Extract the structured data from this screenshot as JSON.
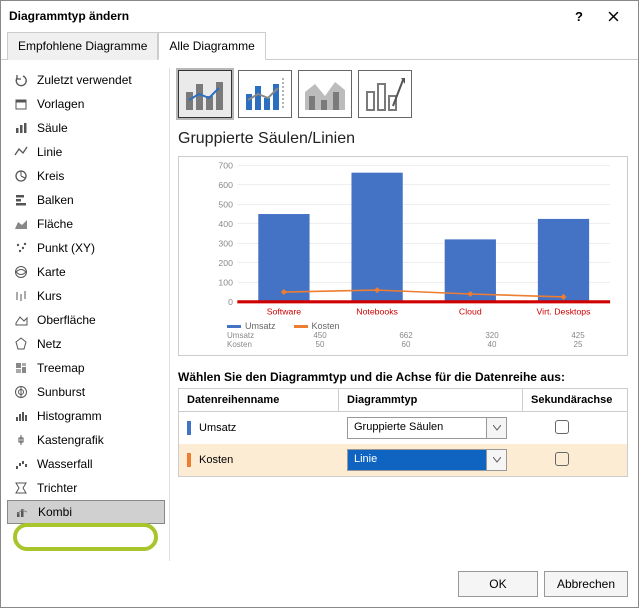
{
  "title": "Diagrammtyp ändern",
  "tabs": {
    "recommended": "Empfohlene Diagramme",
    "all": "Alle Diagramme"
  },
  "sidebar": [
    "Zuletzt verwendet",
    "Vorlagen",
    "Säule",
    "Linie",
    "Kreis",
    "Balken",
    "Fläche",
    "Punkt (XY)",
    "Karte",
    "Kurs",
    "Oberfläche",
    "Netz",
    "Treemap",
    "Sunburst",
    "Histogramm",
    "Kastengrafik",
    "Wasserfall",
    "Trichter",
    "Kombi"
  ],
  "subtypeHeading": "Gruppierte Säulen/Linien",
  "chart_data": {
    "type": "bar",
    "categories": [
      "Software",
      "Notebooks",
      "Cloud",
      "Virt. Desktops"
    ],
    "y_ticks": [
      0,
      100,
      200,
      300,
      400,
      500,
      600,
      700
    ],
    "series": [
      {
        "name": "Umsatz",
        "type": "bar",
        "color": "#4472c4",
        "values": [
          450,
          662,
          320,
          425
        ]
      },
      {
        "name": "Kosten",
        "type": "line",
        "color": "#ed7d31",
        "values": [
          50,
          60,
          40,
          25
        ]
      }
    ],
    "ylim": [
      0,
      700
    ]
  },
  "prompt": "Wählen Sie den Diagrammtyp und die Achse für die Datenreihe aus:",
  "table": {
    "head": {
      "name": "Datenreihenname",
      "type": "Diagrammtyp",
      "axis": "Sekundärachse"
    },
    "rows": [
      {
        "name": "Umsatz",
        "swatch": "#4472c4",
        "type": "Gruppierte Säulen",
        "highlight": false,
        "checked": false
      },
      {
        "name": "Kosten",
        "swatch": "#ed7d31",
        "type": "Linie",
        "highlight": true,
        "checked": false
      }
    ]
  },
  "footer": {
    "ok": "OK",
    "cancel": "Abbrechen"
  }
}
